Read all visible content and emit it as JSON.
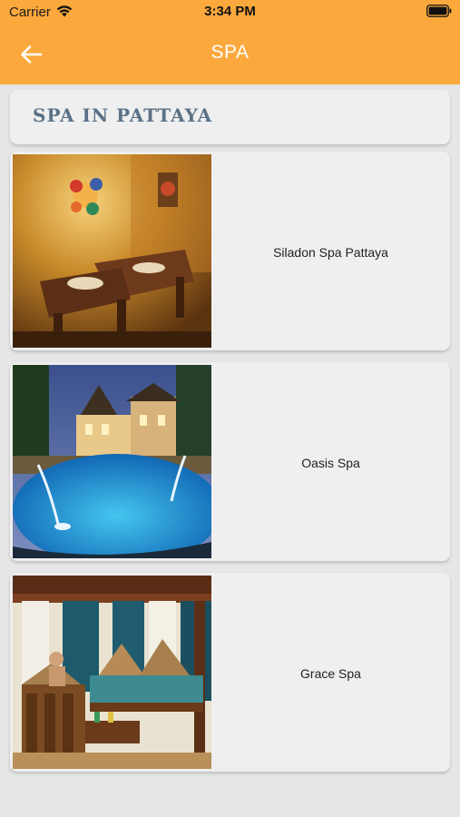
{
  "status_bar": {
    "carrier": "Carrier",
    "time": "3:34 PM"
  },
  "nav": {
    "title": "SPA",
    "back_icon": "arrow-left-icon"
  },
  "section": {
    "title": "SPA IN PATTAYA"
  },
  "spas": [
    {
      "name": "Siladon Spa Pattaya"
    },
    {
      "name": "Oasis Spa"
    },
    {
      "name": "Grace Spa"
    }
  ],
  "colors": {
    "header_bg": "#fba93d",
    "section_title": "#5b7286",
    "page_bg": "#e6e6e6",
    "card_bg": "#efeff0"
  }
}
